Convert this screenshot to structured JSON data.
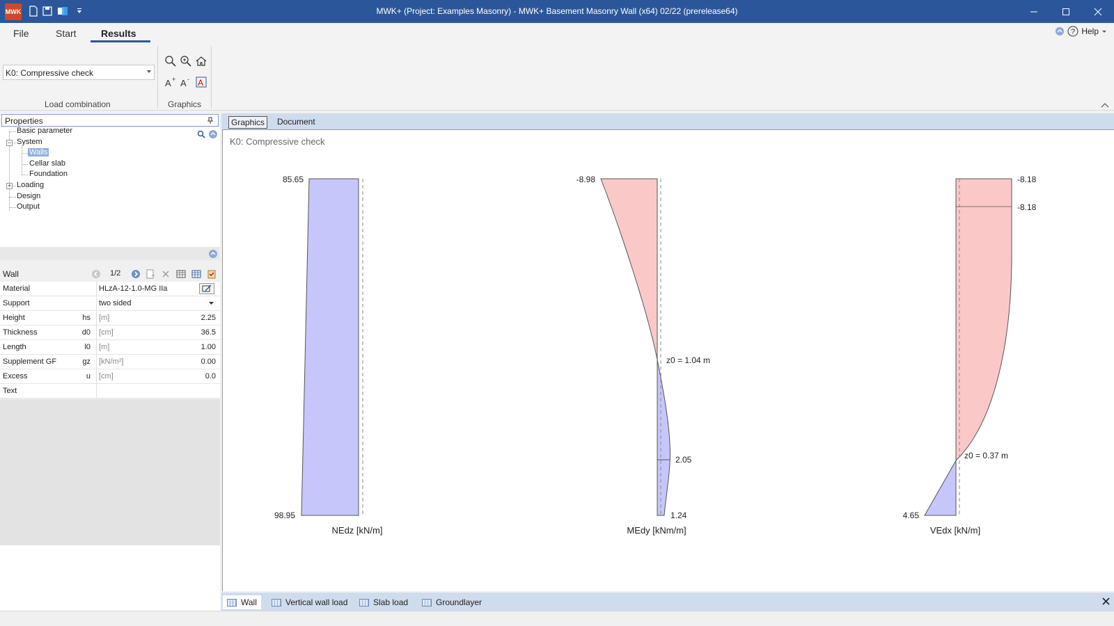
{
  "window": {
    "title": "MWK+ (Project: Examples Masonry) - MWK+ Basement Masonry Wall (x64) 02/22 (prerelease64)",
    "logo_text": "MWK"
  },
  "menu": {
    "file": "File",
    "start": "Start",
    "results": "Results",
    "help": "Help"
  },
  "ribbon": {
    "load_combination_value": "K0: Compressive check",
    "load_combination_label": "Load combination",
    "graphics_label": "Graphics"
  },
  "properties": {
    "header": "Properties",
    "tree": {
      "basic_parameter": "Basic parameter",
      "system": "System",
      "walls": "Walls",
      "cellar_slab": "Cellar slab",
      "foundation": "Foundation",
      "loading": "Loading",
      "design": "Design",
      "output": "Output"
    }
  },
  "wall_panel": {
    "title": "Wall",
    "pager": "1/2",
    "rows": [
      {
        "label": "Material",
        "symbol": "",
        "unit": "",
        "value": "HLzA-12-1.0-MG IIa"
      },
      {
        "label": "Support",
        "symbol": "",
        "unit": "",
        "value": "two sided"
      },
      {
        "label": "Height",
        "symbol": "hs",
        "unit": "[m]",
        "value": "2.25"
      },
      {
        "label": "Thickness",
        "symbol": "d0",
        "unit": "[cm]",
        "value": "36.5"
      },
      {
        "label": "Length",
        "symbol": "l0",
        "unit": "[m]",
        "value": "1.00"
      },
      {
        "label": "Supplement GF",
        "symbol": "gz",
        "unit": "[kN/m²]",
        "value": "0.00"
      },
      {
        "label": "Excess",
        "symbol": "u",
        "unit": "[cm]",
        "value": "0.0"
      },
      {
        "label": "Text",
        "symbol": "",
        "unit": "",
        "value": ""
      }
    ]
  },
  "doc_tabs": {
    "graphics": "Graphics",
    "document": "Document"
  },
  "view": {
    "title": "K0: Compressive check"
  },
  "diagrams": {
    "nedz": {
      "label": "NEdz [kN/m]",
      "top_value": "85.65",
      "bottom_value": "98.95"
    },
    "medy": {
      "label": "MEdy [kNm/m]",
      "top_value": "-8.98",
      "z0_label": "z0 = 1.04 m",
      "mid_value": "2.05",
      "bottom_value": "1.24"
    },
    "vedx": {
      "label": "VEdx [kN/m]",
      "top_value": "-8.18",
      "second_value": "-8.18",
      "z0_label": "z0 = 0.37 m",
      "bottom_value": "4.65"
    },
    "colors": {
      "positive_fill": "#c6c6fb",
      "negative_fill": "#fbc8c8",
      "outline": "#555555"
    }
  },
  "bottom_tabs": {
    "wall": "Wall",
    "vertical_wall_load": "Vertical wall load",
    "slab_load": "Slab load",
    "groundlayer": "Groundlayer"
  }
}
